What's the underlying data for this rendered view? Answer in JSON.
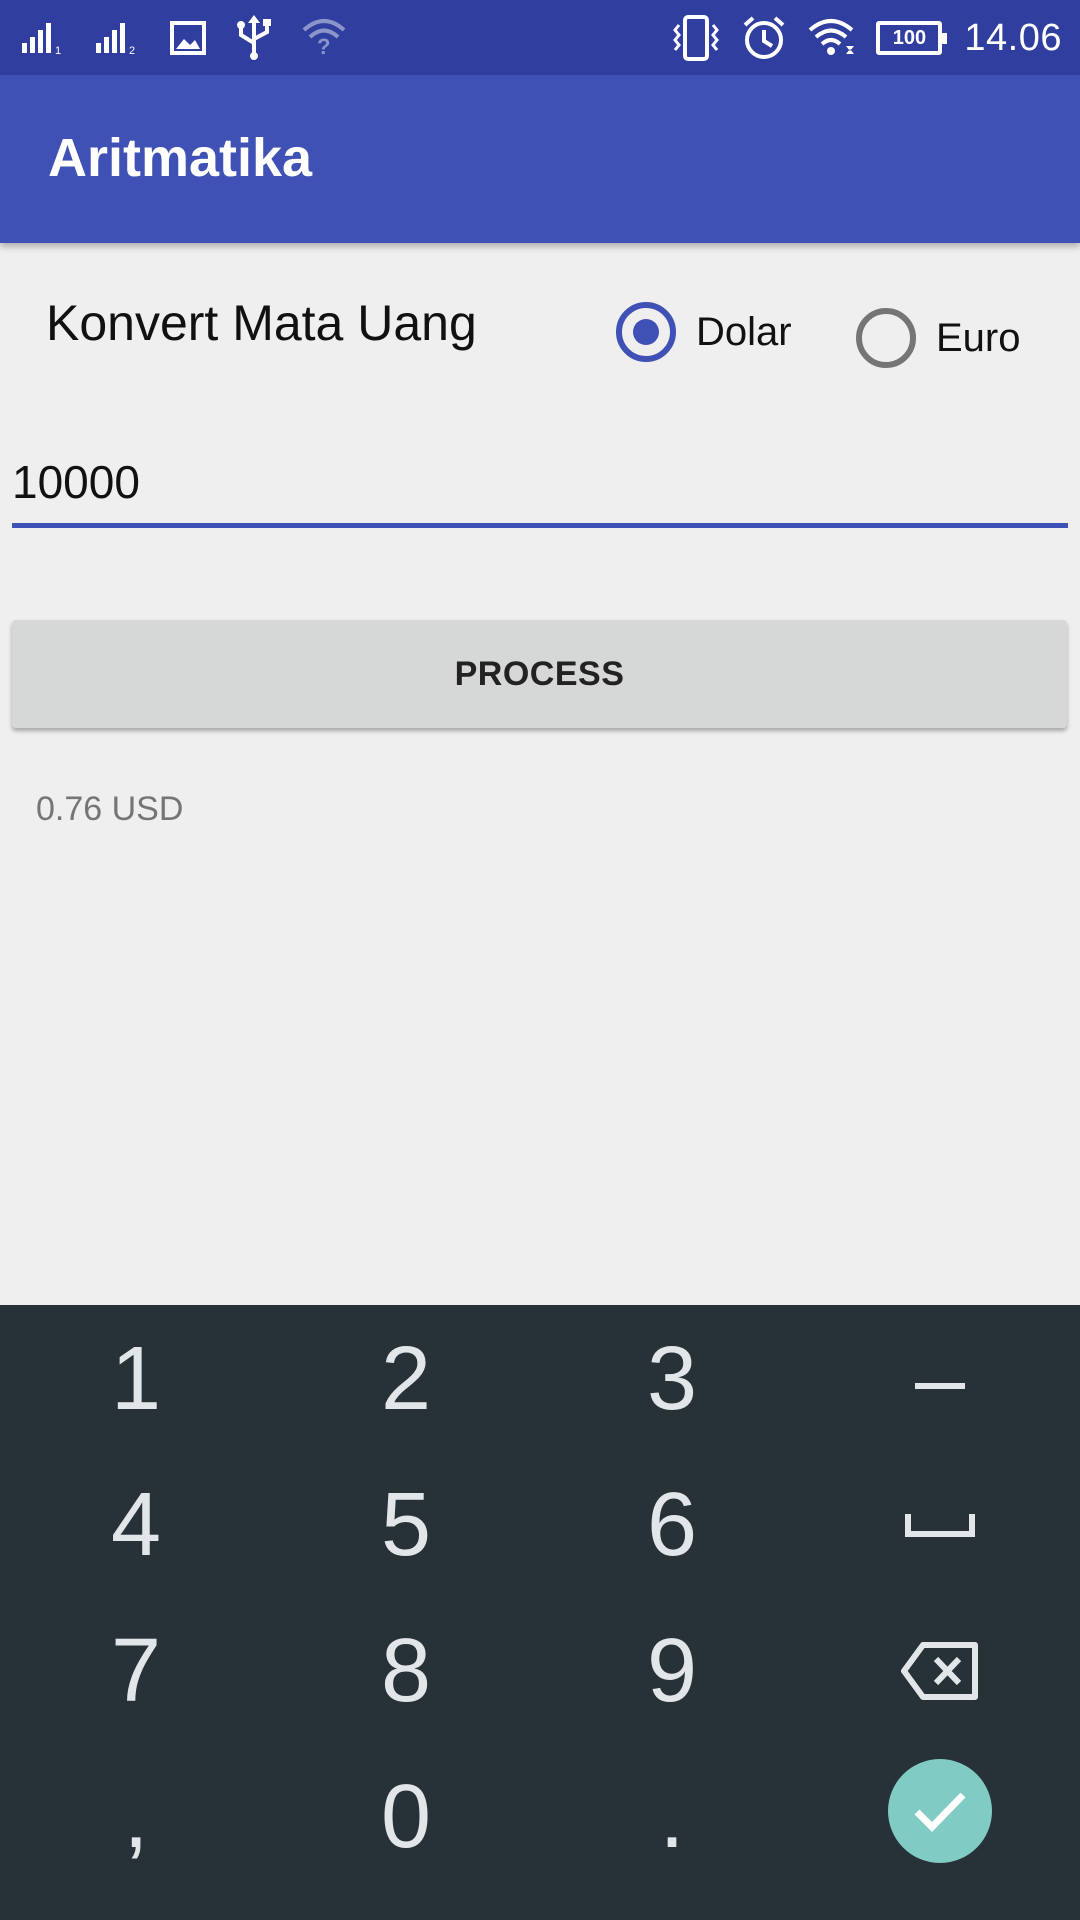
{
  "status_bar": {
    "time": "14.06",
    "battery": "100",
    "icons": [
      "signal-sim1-icon",
      "signal-sim2-icon",
      "image-icon",
      "usb-icon",
      "wifi-unknown-icon",
      "vibrate-icon",
      "alarm-icon",
      "wifi-icon",
      "battery-icon"
    ]
  },
  "app_bar": {
    "title": "Aritmatika"
  },
  "converter": {
    "heading": "Konvert Mata Uang",
    "options": [
      {
        "label": "Dolar",
        "selected": true
      },
      {
        "label": "Euro",
        "selected": false
      }
    ],
    "amount_value": "10000",
    "process_label": "PROCESS",
    "result": "0.76 USD"
  },
  "keyboard": {
    "rows": [
      [
        "1",
        "2",
        "3",
        "–"
      ],
      [
        "4",
        "5",
        "6",
        "space-icon"
      ],
      [
        "7",
        "8",
        "9",
        "backspace-icon"
      ],
      [
        ",",
        "0",
        ".",
        "done-icon"
      ]
    ],
    "accent": "#80cbc4",
    "background": "#263238"
  },
  "colors": {
    "status_bar": "#303f9f",
    "app_bar": "#3f51b5",
    "accent": "#3f51b5",
    "background": "#efefef",
    "button": "#d6d7d7"
  }
}
